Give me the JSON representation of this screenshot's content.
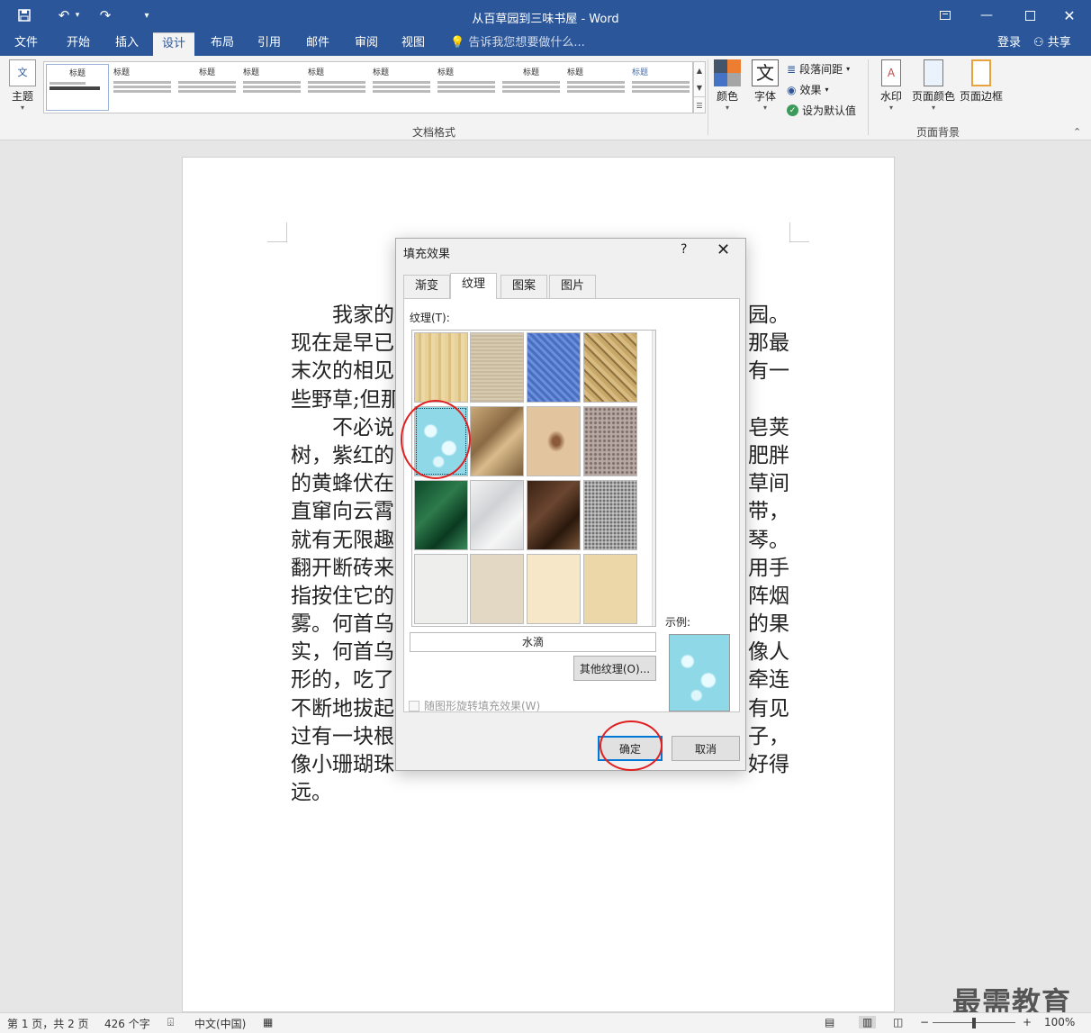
{
  "window": {
    "title": "从百草园到三味书屋 - Word"
  },
  "ribbon_tabs": [
    "文件",
    "开始",
    "插入",
    "设计",
    "布局",
    "引用",
    "邮件",
    "审阅",
    "视图"
  ],
  "tell_me": "告诉我您想要做什么...",
  "account": {
    "login": "登录",
    "share": "共享"
  },
  "ribbon": {
    "theme_label": "主题",
    "gallery_thumbs": [
      "标题",
      "标题",
      "标题",
      "标题",
      "标题",
      "标题",
      "标题",
      "标题",
      "标题",
      "标题"
    ],
    "group_doc_format": "文档格式",
    "colors_label": "颜色",
    "fonts_label": "字体",
    "paragraph_spacing": "段落间距",
    "effects": "效果",
    "set_default": "设为默认值",
    "watermark": "水印",
    "page_color": "页面颜色",
    "page_borders": "页面边框",
    "group_page_background": "页面背景"
  },
  "document": {
    "paragraph1_lines": [
      "我家的",
      "现在是早已",
      "末次的相见",
      "些野草;但那"
    ],
    "paragraph1_right": [
      "园。",
      "那最",
      "有一",
      ""
    ],
    "paragraph2_lines": [
      "不必说",
      "树，紫红的",
      "的黄蜂伏在",
      "直窜向云霄",
      "就有无限趣",
      "翻开断砖来",
      "指按住它的",
      "雾。何首乌",
      "实，何首乌",
      "形的，吃了",
      "不断地拔起",
      "过有一块根",
      "像小珊瑚珠",
      "远。"
    ],
    "paragraph2_right": [
      "皂荚",
      "肥胖",
      "草间",
      "带，",
      "琴。",
      "用手",
      "阵烟",
      "的果",
      "像人",
      "牵连",
      "有见",
      "子，",
      "好得",
      ""
    ]
  },
  "dialog": {
    "title": "填充效果",
    "help": "?",
    "tabs": [
      "渐变",
      "纹理",
      "图案",
      "图片"
    ],
    "active_tab": "纹理",
    "texture_label": "纹理(T):",
    "selected_texture": "水滴",
    "other_texture_button": "其他纹理(O)...",
    "rotate_checkbox": "随图形旋转填充效果(W)",
    "sample_label": "示例:",
    "ok": "确定",
    "cancel": "取消",
    "textures": [
      "papyrus",
      "canvas",
      "denim",
      "woven",
      "water-droplets",
      "brown-bag",
      "fish-fossil",
      "granite",
      "green-marble",
      "white-marble",
      "brown-marble",
      "gray-granite",
      "recycled-paper",
      "parchment",
      "stationery",
      "sand"
    ]
  },
  "statusbar": {
    "page": "第 1 页，共 2 页",
    "words": "426 个字",
    "language": "中文(中国)",
    "zoom": "100%"
  },
  "watermark_overlay": "最需教育"
}
